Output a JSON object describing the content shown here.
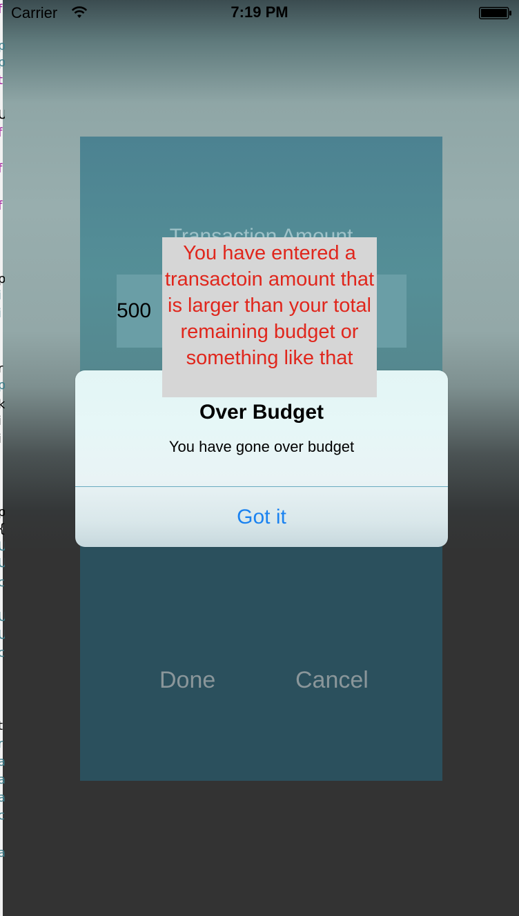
{
  "status_bar": {
    "carrier": "Carrier",
    "time": "7:19 PM",
    "icons": [
      "wifi-icon",
      "battery-icon"
    ]
  },
  "panel": {
    "amount_label": "Transaction Amount",
    "amount_value": "500",
    "done_label": "Done",
    "cancel_label": "Cancel"
  },
  "warning": {
    "text": "You have entered a transactoin amount that is larger than your total remaining budget or something like that",
    "color": "#e0261c"
  },
  "alert": {
    "title": "Over Budget",
    "message": "You have gone over budget",
    "button_label": "Got it",
    "button_color": "#1a82f0"
  },
  "background_fragments": [
    {
      "text": "f",
      "color": "#a0189a"
    },
    {
      "text": "p",
      "color": "#3c7d8a"
    },
    {
      "text": "p",
      "color": "#3c7d8a"
    },
    {
      "text": "t",
      "color": "#a0189a"
    },
    {
      "text": "U",
      "color": "#000000"
    },
    {
      "text": "f",
      "color": "#a0189a"
    },
    {
      "text": "f",
      "color": "#a0189a"
    },
    {
      "text": "f",
      "color": "#a0189a"
    },
    {
      "text": "p",
      "color": "#000000"
    },
    {
      "text": "i",
      "color": "#3c7d8a"
    },
    {
      "text": "i",
      "color": "#3c7d8a"
    },
    {
      "text": "r",
      "color": "#000000"
    },
    {
      "text": "p",
      "color": "#3c7d8a"
    },
    {
      "text": "k",
      "color": "#000000"
    },
    {
      "text": "i",
      "color": "#000000"
    },
    {
      "text": "i",
      "color": "#000000"
    },
    {
      "text": "p",
      "color": "#000000"
    },
    {
      "text": "{",
      "color": "#000000"
    },
    {
      "text": "U",
      "color": "#3c7d8a"
    },
    {
      "text": "U",
      "color": "#3c7d8a"
    },
    {
      "text": "c",
      "color": "#3c7d8a"
    },
    {
      "text": "U",
      "color": "#3c7d8a"
    },
    {
      "text": "U",
      "color": "#3c7d8a"
    },
    {
      "text": "c",
      "color": "#3c7d8a"
    },
    {
      "text": "t",
      "color": "#000000"
    },
    {
      "text": "r",
      "color": "#3c7d8a"
    },
    {
      "text": "a",
      "color": "#3c7d8a"
    },
    {
      "text": "a",
      "color": "#3c7d8a"
    },
    {
      "text": "a",
      "color": "#3c7d8a"
    },
    {
      "text": "c",
      "color": "#3c7d8a"
    },
    {
      "text": "a",
      "color": "#3c7d8a"
    }
  ]
}
